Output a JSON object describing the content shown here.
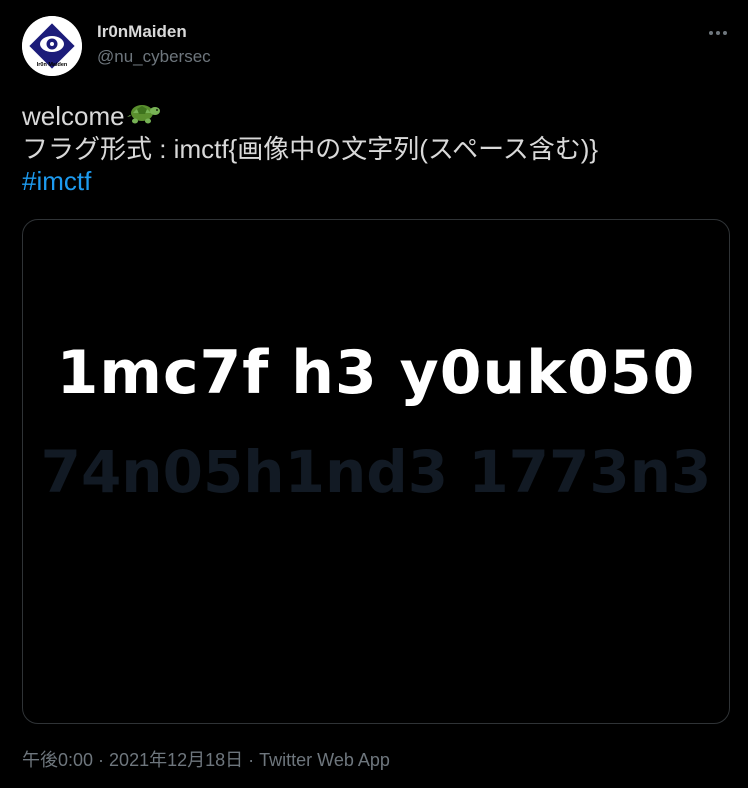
{
  "author": {
    "display_name": "Ir0nMaiden",
    "handle": "@nu_cybersec",
    "avatar_text": "Ir0n Maiden"
  },
  "tweet": {
    "line1": "welcome",
    "line1_emoji": "turtle-emoji",
    "line2": "フラグ形式 : imctf{画像中の文字列(スペース含む)}",
    "hashtag": "#imctf"
  },
  "media": {
    "visible_text": "1mc7f h3 y0uk050",
    "hidden_text": "74n05h1nd3 1773n3"
  },
  "meta": {
    "time": "午後0:00",
    "separator1": " · ",
    "date": "2021年12月18日",
    "separator2": " · ",
    "source": "Twitter Web App"
  },
  "colors": {
    "background": "#000000",
    "text": "#d9d9d9",
    "secondary": "#6e767d",
    "link": "#1d9bf0",
    "hidden_text": "#121a24"
  },
  "icons": {
    "more": "more-horizontal-icon",
    "avatar": "eye-logo"
  }
}
